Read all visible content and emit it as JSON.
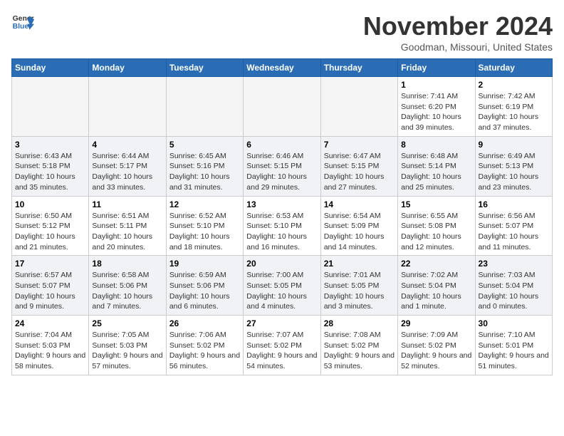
{
  "logo": {
    "line1": "General",
    "line2": "Blue"
  },
  "title": "November 2024",
  "location": "Goodman, Missouri, United States",
  "days_header": [
    "Sunday",
    "Monday",
    "Tuesday",
    "Wednesday",
    "Thursday",
    "Friday",
    "Saturday"
  ],
  "weeks": [
    [
      {
        "day": "",
        "empty": true
      },
      {
        "day": "",
        "empty": true
      },
      {
        "day": "",
        "empty": true
      },
      {
        "day": "",
        "empty": true
      },
      {
        "day": "",
        "empty": true
      },
      {
        "day": "1",
        "sunrise": "Sunrise: 7:41 AM",
        "sunset": "Sunset: 6:20 PM",
        "daylight": "Daylight: 10 hours and 39 minutes."
      },
      {
        "day": "2",
        "sunrise": "Sunrise: 7:42 AM",
        "sunset": "Sunset: 6:19 PM",
        "daylight": "Daylight: 10 hours and 37 minutes."
      }
    ],
    [
      {
        "day": "3",
        "sunrise": "Sunrise: 6:43 AM",
        "sunset": "Sunset: 5:18 PM",
        "daylight": "Daylight: 10 hours and 35 minutes."
      },
      {
        "day": "4",
        "sunrise": "Sunrise: 6:44 AM",
        "sunset": "Sunset: 5:17 PM",
        "daylight": "Daylight: 10 hours and 33 minutes."
      },
      {
        "day": "5",
        "sunrise": "Sunrise: 6:45 AM",
        "sunset": "Sunset: 5:16 PM",
        "daylight": "Daylight: 10 hours and 31 minutes."
      },
      {
        "day": "6",
        "sunrise": "Sunrise: 6:46 AM",
        "sunset": "Sunset: 5:15 PM",
        "daylight": "Daylight: 10 hours and 29 minutes."
      },
      {
        "day": "7",
        "sunrise": "Sunrise: 6:47 AM",
        "sunset": "Sunset: 5:15 PM",
        "daylight": "Daylight: 10 hours and 27 minutes."
      },
      {
        "day": "8",
        "sunrise": "Sunrise: 6:48 AM",
        "sunset": "Sunset: 5:14 PM",
        "daylight": "Daylight: 10 hours and 25 minutes."
      },
      {
        "day": "9",
        "sunrise": "Sunrise: 6:49 AM",
        "sunset": "Sunset: 5:13 PM",
        "daylight": "Daylight: 10 hours and 23 minutes."
      }
    ],
    [
      {
        "day": "10",
        "sunrise": "Sunrise: 6:50 AM",
        "sunset": "Sunset: 5:12 PM",
        "daylight": "Daylight: 10 hours and 21 minutes."
      },
      {
        "day": "11",
        "sunrise": "Sunrise: 6:51 AM",
        "sunset": "Sunset: 5:11 PM",
        "daylight": "Daylight: 10 hours and 20 minutes."
      },
      {
        "day": "12",
        "sunrise": "Sunrise: 6:52 AM",
        "sunset": "Sunset: 5:10 PM",
        "daylight": "Daylight: 10 hours and 18 minutes."
      },
      {
        "day": "13",
        "sunrise": "Sunrise: 6:53 AM",
        "sunset": "Sunset: 5:10 PM",
        "daylight": "Daylight: 10 hours and 16 minutes."
      },
      {
        "day": "14",
        "sunrise": "Sunrise: 6:54 AM",
        "sunset": "Sunset: 5:09 PM",
        "daylight": "Daylight: 10 hours and 14 minutes."
      },
      {
        "day": "15",
        "sunrise": "Sunrise: 6:55 AM",
        "sunset": "Sunset: 5:08 PM",
        "daylight": "Daylight: 10 hours and 12 minutes."
      },
      {
        "day": "16",
        "sunrise": "Sunrise: 6:56 AM",
        "sunset": "Sunset: 5:07 PM",
        "daylight": "Daylight: 10 hours and 11 minutes."
      }
    ],
    [
      {
        "day": "17",
        "sunrise": "Sunrise: 6:57 AM",
        "sunset": "Sunset: 5:07 PM",
        "daylight": "Daylight: 10 hours and 9 minutes."
      },
      {
        "day": "18",
        "sunrise": "Sunrise: 6:58 AM",
        "sunset": "Sunset: 5:06 PM",
        "daylight": "Daylight: 10 hours and 7 minutes."
      },
      {
        "day": "19",
        "sunrise": "Sunrise: 6:59 AM",
        "sunset": "Sunset: 5:06 PM",
        "daylight": "Daylight: 10 hours and 6 minutes."
      },
      {
        "day": "20",
        "sunrise": "Sunrise: 7:00 AM",
        "sunset": "Sunset: 5:05 PM",
        "daylight": "Daylight: 10 hours and 4 minutes."
      },
      {
        "day": "21",
        "sunrise": "Sunrise: 7:01 AM",
        "sunset": "Sunset: 5:05 PM",
        "daylight": "Daylight: 10 hours and 3 minutes."
      },
      {
        "day": "22",
        "sunrise": "Sunrise: 7:02 AM",
        "sunset": "Sunset: 5:04 PM",
        "daylight": "Daylight: 10 hours and 1 minute."
      },
      {
        "day": "23",
        "sunrise": "Sunrise: 7:03 AM",
        "sunset": "Sunset: 5:04 PM",
        "daylight": "Daylight: 10 hours and 0 minutes."
      }
    ],
    [
      {
        "day": "24",
        "sunrise": "Sunrise: 7:04 AM",
        "sunset": "Sunset: 5:03 PM",
        "daylight": "Daylight: 9 hours and 58 minutes."
      },
      {
        "day": "25",
        "sunrise": "Sunrise: 7:05 AM",
        "sunset": "Sunset: 5:03 PM",
        "daylight": "Daylight: 9 hours and 57 minutes."
      },
      {
        "day": "26",
        "sunrise": "Sunrise: 7:06 AM",
        "sunset": "Sunset: 5:02 PM",
        "daylight": "Daylight: 9 hours and 56 minutes."
      },
      {
        "day": "27",
        "sunrise": "Sunrise: 7:07 AM",
        "sunset": "Sunset: 5:02 PM",
        "daylight": "Daylight: 9 hours and 54 minutes."
      },
      {
        "day": "28",
        "sunrise": "Sunrise: 7:08 AM",
        "sunset": "Sunset: 5:02 PM",
        "daylight": "Daylight: 9 hours and 53 minutes."
      },
      {
        "day": "29",
        "sunrise": "Sunrise: 7:09 AM",
        "sunset": "Sunset: 5:02 PM",
        "daylight": "Daylight: 9 hours and 52 minutes."
      },
      {
        "day": "30",
        "sunrise": "Sunrise: 7:10 AM",
        "sunset": "Sunset: 5:01 PM",
        "daylight": "Daylight: 9 hours and 51 minutes."
      }
    ]
  ]
}
